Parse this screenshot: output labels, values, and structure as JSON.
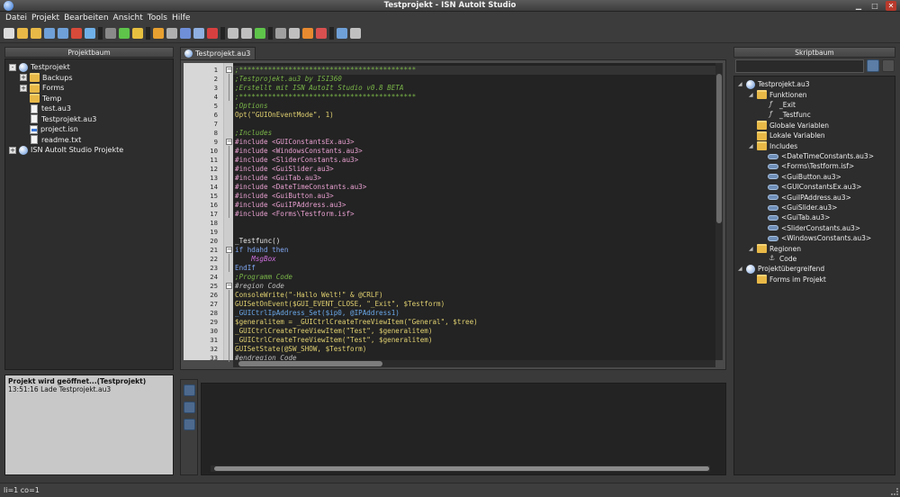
{
  "window": {
    "title": "Testprojekt - ISN AutoIt Studio",
    "controls": [
      "minimize",
      "maximize",
      "close"
    ]
  },
  "menu": [
    "Datei",
    "Projekt",
    "Bearbeiten",
    "Ansicht",
    "Tools",
    "Hilfe"
  ],
  "toolbar": {
    "icons": [
      "new-file-icon",
      "open-folder-icon",
      "open-project-icon",
      "save-icon",
      "save-all-icon",
      "close-icon",
      "web-icon",
      "refresh-icon",
      "run-icon",
      "favorite-icon",
      "compile-icon",
      "tools-icon",
      "save-as-icon",
      "new-window-icon",
      "record-icon",
      "undo-icon",
      "redo-icon",
      "sync-icon",
      "settings-icon",
      "search-icon",
      "bug-icon",
      "pen-icon",
      "picker-icon",
      "more-icon"
    ]
  },
  "left_panel": {
    "title": "Projektbaum",
    "tree": [
      {
        "label": "Testprojekt",
        "level": 0,
        "expander": "-",
        "icon": "project-icon"
      },
      {
        "label": "Backups",
        "level": 1,
        "expander": "+",
        "icon": "folder-icon"
      },
      {
        "label": "Forms",
        "level": 1,
        "expander": "+",
        "icon": "folder-icon"
      },
      {
        "label": "Temp",
        "level": 1,
        "expander": "",
        "icon": "folder-icon"
      },
      {
        "label": "test.au3",
        "level": 1,
        "expander": "",
        "icon": "au3-file-icon"
      },
      {
        "label": "Testprojekt.au3",
        "level": 1,
        "expander": "",
        "icon": "au3-file-icon"
      },
      {
        "label": "project.isn",
        "level": 1,
        "expander": "",
        "icon": "isn-file-icon"
      },
      {
        "label": "readme.txt",
        "level": 1,
        "expander": "",
        "icon": "text-file-icon"
      },
      {
        "label": "ISN AutoIt Studio Projekte",
        "level": 0,
        "expander": "+",
        "icon": "globe-icon"
      }
    ]
  },
  "log": {
    "line1": "Projekt wird geöffnet...(Testprojekt)",
    "line2": "13:51:16  Lade Testprojekt.au3"
  },
  "editor": {
    "tab_label": "Testprojekt.au3",
    "lines": [
      {
        "n": "1",
        "text": ";*******************************************",
        "color": "#7ab648",
        "style": "italic"
      },
      {
        "n": "2",
        "text": ";Testprojekt.au3 by ISI360",
        "color": "#7ab648",
        "style": "italic"
      },
      {
        "n": "3",
        "text": ";Erstellt mit ISN AutoIt Studio v0.8 BETA",
        "color": "#7ab648",
        "style": "italic"
      },
      {
        "n": "4",
        "text": ";*******************************************",
        "color": "#7ab648",
        "style": "italic"
      },
      {
        "n": "5",
        "text": ";Options",
        "color": "#7ab648",
        "style": "italic"
      },
      {
        "n": "6",
        "text": "Opt(\"GUIOnEventMode\", 1)",
        "color": "#e0d070",
        "style": "normal"
      },
      {
        "n": "7",
        "text": "",
        "color": "#ddd",
        "style": "normal"
      },
      {
        "n": "8",
        "text": ";Includes",
        "color": "#7ab648",
        "style": "italic"
      },
      {
        "n": "9",
        "text": "#include <GUIConstantsEx.au3>",
        "color": "#e8a0d0",
        "style": "normal"
      },
      {
        "n": "10",
        "text": "#include <WindowsConstants.au3>",
        "color": "#e8a0d0",
        "style": "normal"
      },
      {
        "n": "11",
        "text": "#include <SliderConstants.au3>",
        "color": "#e8a0d0",
        "style": "normal"
      },
      {
        "n": "12",
        "text": "#include <GuiSlider.au3>",
        "color": "#e8a0d0",
        "style": "normal"
      },
      {
        "n": "13",
        "text": "#include <GuiTab.au3>",
        "color": "#e8a0d0",
        "style": "normal"
      },
      {
        "n": "14",
        "text": "#include <DateTimeConstants.au3>",
        "color": "#e8a0d0",
        "style": "normal"
      },
      {
        "n": "15",
        "text": "#include <GuiButton.au3>",
        "color": "#e8a0d0",
        "style": "normal"
      },
      {
        "n": "16",
        "text": "#include <GuiIPAddress.au3>",
        "color": "#e8a0d0",
        "style": "normal"
      },
      {
        "n": "17",
        "text": "#include <Forms\\Testform.isf>",
        "color": "#e8a0d0",
        "style": "normal"
      },
      {
        "n": "18",
        "text": "",
        "color": "#ddd",
        "style": "normal"
      },
      {
        "n": "19",
        "text": "",
        "color": "#ddd",
        "style": "normal"
      },
      {
        "n": "20",
        "text": "_Testfunc()",
        "color": "#e8e8e8",
        "style": "normal"
      },
      {
        "n": "21",
        "text": "if hdahd then",
        "color": "#7fa6f0",
        "style": "normal"
      },
      {
        "n": "22",
        "text": "    MsgBox",
        "color": "#d070e0",
        "style": "italic"
      },
      {
        "n": "23",
        "text": "EndIf",
        "color": "#7fa6f0",
        "style": "normal"
      },
      {
        "n": "24",
        "text": ";Programm Code",
        "color": "#7ab648",
        "style": "italic"
      },
      {
        "n": "25",
        "text": "#region Code",
        "color": "#bdbdbd",
        "style": "italic"
      },
      {
        "n": "26",
        "text": "ConsoleWrite(\"-Hallo Welt!\" & @CRLF)",
        "color": "#e0d070",
        "style": "normal"
      },
      {
        "n": "27",
        "text": "GUISetOnEvent($GUI_EVENT_CLOSE, \"_Exit\", $Testform)",
        "color": "#e0d070",
        "style": "normal"
      },
      {
        "n": "28",
        "text": "_GUICtrlIpAddress_Set($ip0, @IPAddress1)",
        "color": "#6aa8e8",
        "style": "normal"
      },
      {
        "n": "29",
        "text": "$generalitem = _GUICtrlCreateTreeViewItem(\"General\", $tree)",
        "color": "#e0d070",
        "style": "normal"
      },
      {
        "n": "30",
        "text": "_GUICtrlCreateTreeViewItem(\"Test\", $generalitem)",
        "color": "#e0d070",
        "style": "normal"
      },
      {
        "n": "31",
        "text": "_GUICtrlCreateTreeViewItem(\"Test\", $generalitem)",
        "color": "#e0d070",
        "style": "normal"
      },
      {
        "n": "32",
        "text": "GUISetState(@SW_SHOW, $Testform)",
        "color": "#e0d070",
        "style": "normal"
      },
      {
        "n": "33",
        "text": "#endregion Code",
        "color": "#bdbdbd",
        "style": "italic"
      }
    ]
  },
  "right_panel": {
    "title": "Skriptbaum",
    "search_placeholder": "",
    "tree": [
      {
        "label": "Testprojekt.au3",
        "level": 0,
        "tri": "◢",
        "icon": "au3-file-icon"
      },
      {
        "label": "Funktionen",
        "level": 1,
        "tri": "◢",
        "icon": "folder-icon"
      },
      {
        "label": "_Exit",
        "level": 2,
        "tri": "",
        "icon": "function-icon"
      },
      {
        "label": "_Testfunc",
        "level": 2,
        "tri": "",
        "icon": "function-icon"
      },
      {
        "label": "Globale Variablen",
        "level": 1,
        "tri": "",
        "icon": "folder-icon"
      },
      {
        "label": "Lokale Variablen",
        "level": 1,
        "tri": "",
        "icon": "folder-icon"
      },
      {
        "label": "Includes",
        "level": 1,
        "tri": "◢",
        "icon": "folder-icon"
      },
      {
        "label": "<DateTimeConstants.au3>",
        "level": 2,
        "tri": "",
        "icon": "include-icon"
      },
      {
        "label": "<Forms\\Testform.isf>",
        "level": 2,
        "tri": "",
        "icon": "include-icon"
      },
      {
        "label": "<GuiButton.au3>",
        "level": 2,
        "tri": "",
        "icon": "include-icon"
      },
      {
        "label": "<GUIConstantsEx.au3>",
        "level": 2,
        "tri": "",
        "icon": "include-icon"
      },
      {
        "label": "<GuiIPAddress.au3>",
        "level": 2,
        "tri": "",
        "icon": "include-icon"
      },
      {
        "label": "<GuiSlider.au3>",
        "level": 2,
        "tri": "",
        "icon": "include-icon"
      },
      {
        "label": "<GuiTab.au3>",
        "level": 2,
        "tri": "",
        "icon": "include-icon"
      },
      {
        "label": "<SliderConstants.au3>",
        "level": 2,
        "tri": "",
        "icon": "include-icon"
      },
      {
        "label": "<WindowsConstants.au3>",
        "level": 2,
        "tri": "",
        "icon": "include-icon"
      },
      {
        "label": "Regionen",
        "level": 1,
        "tri": "◢",
        "icon": "folder-icon"
      },
      {
        "label": "Code",
        "level": 2,
        "tri": "",
        "icon": "anchor-icon"
      },
      {
        "label": "Projektübergreifend",
        "level": 0,
        "tri": "◢",
        "icon": "globe-icon"
      },
      {
        "label": "Forms im Projekt",
        "level": 1,
        "tri": "",
        "icon": "folder-icon"
      }
    ]
  },
  "statusbar": {
    "text": "li=1 co=1"
  },
  "colors": {
    "background": "#3a3a3a",
    "editor_bg": "#232323",
    "comment": "#7ab648",
    "keyword": "#7fa6f0",
    "function": "#e0d070",
    "include": "#e8a0d0"
  }
}
